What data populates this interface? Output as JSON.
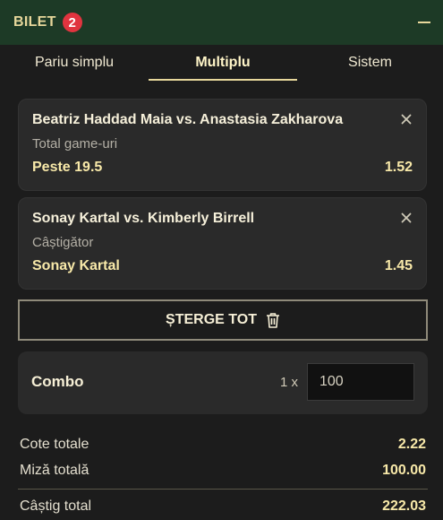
{
  "header": {
    "title": "BILET",
    "badge_count": "2"
  },
  "tabs": [
    {
      "label": "Pariu simplu",
      "active": false
    },
    {
      "label": "Multiplu",
      "active": true
    },
    {
      "label": "Sistem",
      "active": false
    }
  ],
  "bets": [
    {
      "match": "Beatriz Haddad Maia vs. Anastasia Zakharova",
      "market": "Total game-uri",
      "selection": "Peste 19.5",
      "odds": "1.52"
    },
    {
      "match": "Sonay Kartal vs. Kimberly Birrell",
      "market": "Câștigător",
      "selection": "Sonay Kartal",
      "odds": "1.45"
    }
  ],
  "clear_all": {
    "label": "ȘTERGE TOT",
    "icon": "trash-icon"
  },
  "combo": {
    "label": "Combo",
    "multiplier": "1 x",
    "stake": "100"
  },
  "summary": {
    "total_odds_label": "Cote totale",
    "total_odds": "2.22",
    "total_stake_label": "Miză totală",
    "total_stake": "100.00",
    "total_win_label": "Câștig total",
    "total_win": "222.03"
  },
  "colors": {
    "header_bg": "#1d3a26",
    "accent": "#e7d79b",
    "badge": "#e0343f",
    "panel_bg": "#1c1c1c",
    "card_bg": "#2a2a2a"
  }
}
